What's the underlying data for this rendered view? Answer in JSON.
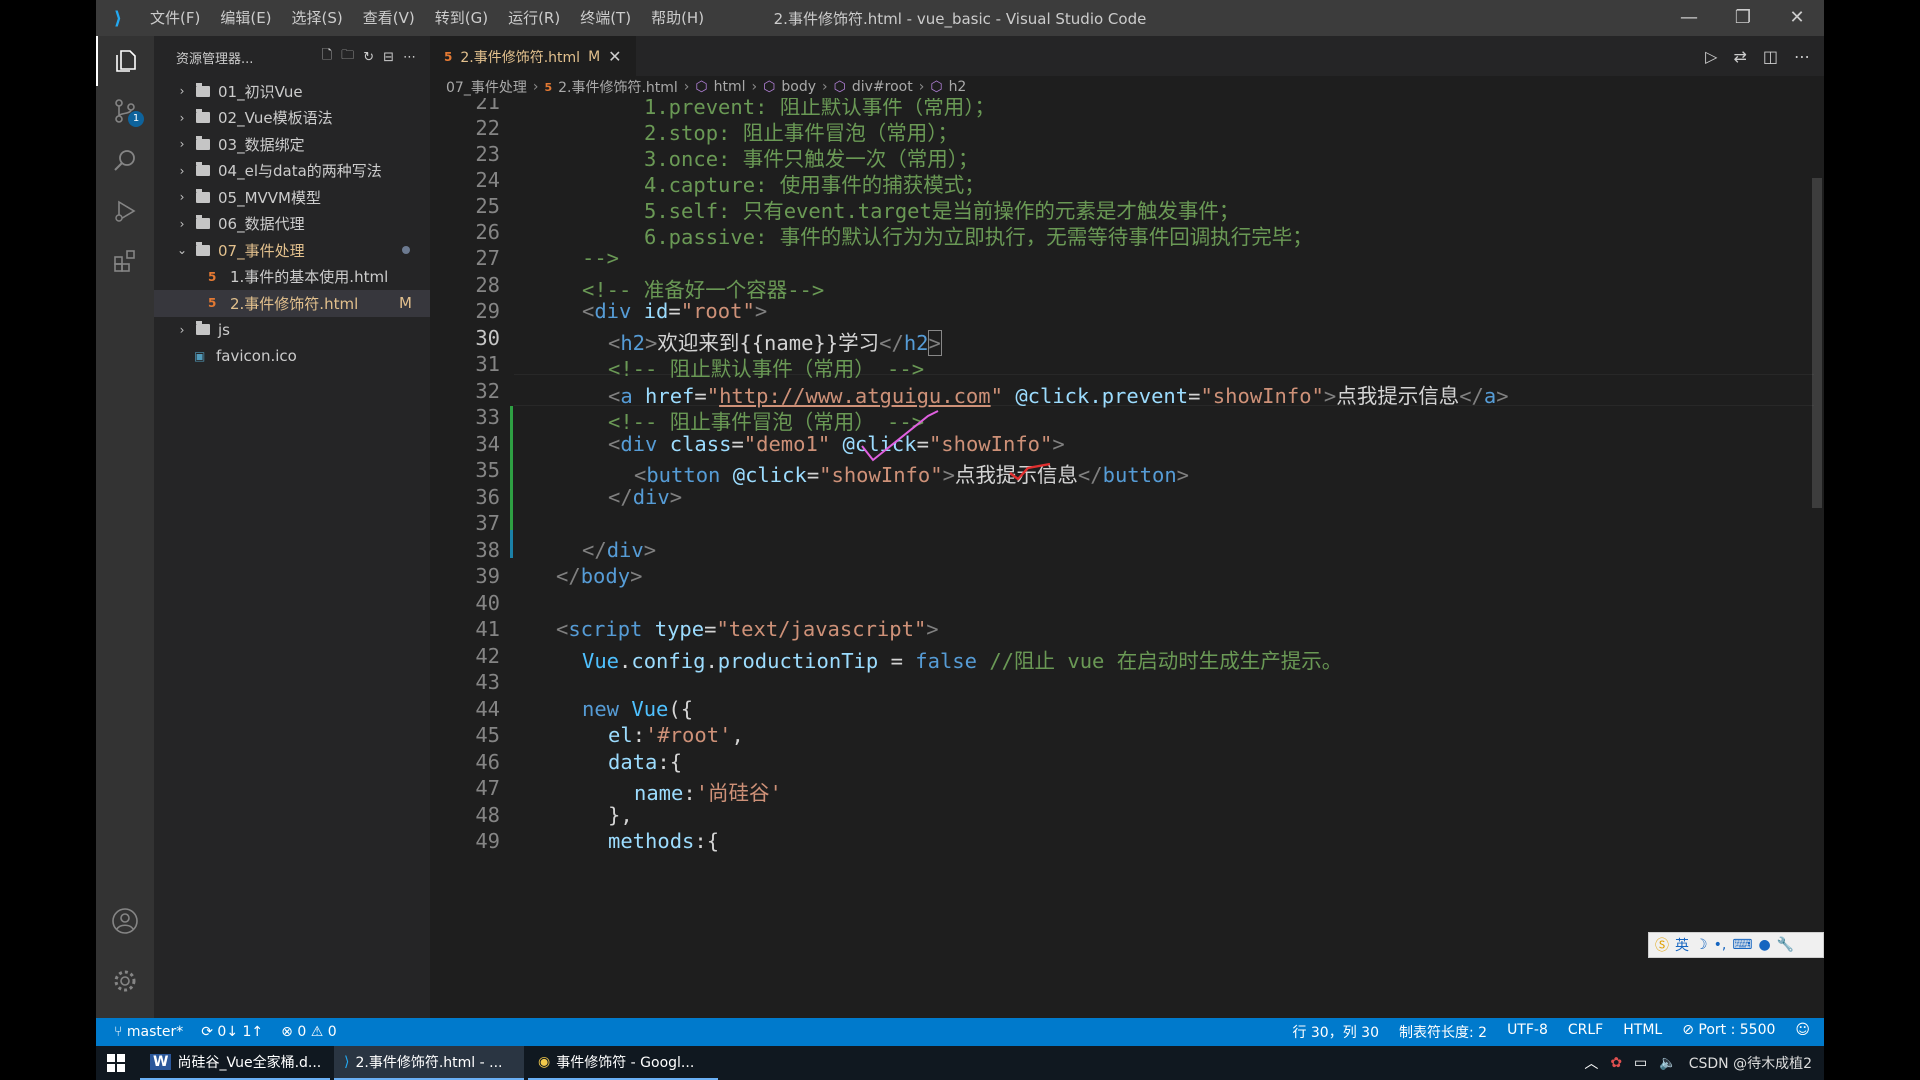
{
  "window": {
    "title": "2.事件修饰符.html - vue_basic - Visual Studio Code",
    "menu": [
      "文件(F)",
      "编辑(E)",
      "选择(S)",
      "查看(V)",
      "转到(G)",
      "运行(R)",
      "终端(T)",
      "帮助(H)"
    ]
  },
  "activity": {
    "scm_badge": "1"
  },
  "sidebar": {
    "title": "资源管理器...",
    "items": [
      {
        "label": "01_初识Vue"
      },
      {
        "label": "02_Vue模板语法"
      },
      {
        "label": "03_数据绑定"
      },
      {
        "label": "04_el与data的两种写法"
      },
      {
        "label": "05_MVVM模型"
      },
      {
        "label": "06_数据代理"
      },
      {
        "label": "07_事件处理"
      },
      {
        "label": "1.事件的基本使用.html"
      },
      {
        "label": "2.事件修饰符.html",
        "badge": "M"
      },
      {
        "label": "js"
      },
      {
        "label": "favicon.ico"
      }
    ]
  },
  "editor": {
    "tab": {
      "label": "2.事件修饰符.html",
      "badge": "M"
    },
    "breadcrumb": [
      "07_事件处理",
      "2.事件修饰符.html",
      "html",
      "body",
      "div#root",
      "h2"
    ],
    "line_numbers": [
      "21",
      "22",
      "23",
      "24",
      "25",
      "26",
      "27",
      "28",
      "29",
      "30",
      "31",
      "32",
      "33",
      "34",
      "35",
      "36",
      "37",
      "38",
      "39",
      "40",
      "41",
      "42",
      "43",
      "44",
      "45",
      "46",
      "47",
      "48",
      "49"
    ],
    "lines": {
      "l21": "1.prevent: 阻止默认事件（常用）；",
      "l22": "2.stop: 阻止事件冒泡（常用）；",
      "l23": "3.once: 事件只触发一次（常用）；",
      "l24": "4.capture: 使用事件的捕获模式；",
      "l25": "5.self: 只有event.target是当前操作的元素是才触发事件；",
      "l26": "6.passive: 事件的默认行为为立即执行，无需等待事件回调执行完毕；",
      "l27": "-->",
      "l28": "<!-- 准备好一个容器-->",
      "l31": "<!-- 阻止默认事件（常用） -->",
      "l33": "<!-- 阻止事件冒泡（常用） -->",
      "l42_comment": "//阻止 vue 在启动时生成生产提示。",
      "h2_text": "欢迎来到{{name}}学习",
      "link_url": "http://www.atguigu.com",
      "link_text": "点我提示信息",
      "button_text": "点我提示信息",
      "name_value": "'尚硅谷'",
      "root_sel": "'#root'"
    }
  },
  "status": {
    "branch": "master*",
    "sync": "0↓ 1↑",
    "errors": "0",
    "warnings": "0",
    "position": "行 30，列 30",
    "tab_size": "制表符长度: 2",
    "encoding": "UTF-8",
    "eol": "CRLF",
    "language": "HTML",
    "port": "Port : 5500"
  },
  "taskbar": {
    "items": [
      "尚硅谷_Vue全家桶.d...",
      "2.事件修饰符.html - ...",
      "事件修饰符 - Googl..."
    ],
    "ime_label": "英",
    "watermark": "CSDN @待木成植2"
  }
}
